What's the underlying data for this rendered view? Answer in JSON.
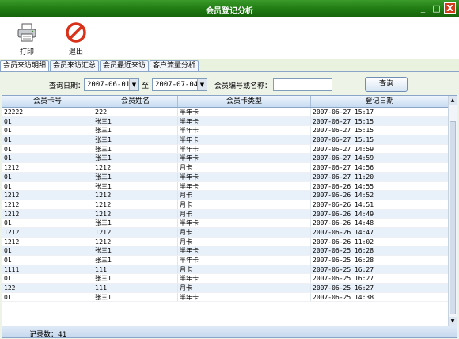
{
  "window": {
    "title": "会员登记分析",
    "buttons": [
      "_",
      "□",
      "X"
    ]
  },
  "toolbar": {
    "print_label": "打印",
    "exit_label": "退出",
    "print_icon": "printer-icon",
    "exit_icon": "no-entry-icon"
  },
  "tabs": [
    "会员来访明细",
    "会员来访汇总",
    "会员最近来访",
    "客户流量分析"
  ],
  "query": {
    "date_label": "查询日期：",
    "start_date": "2007-06-01",
    "to_label": "至",
    "end_date": "2007-07-04",
    "member_label": "会员编号或名称：",
    "member_value": "",
    "search_label": "查询"
  },
  "table": {
    "columns": [
      "会员卡号",
      "会员姓名",
      "会员卡类型",
      "登记日期"
    ],
    "rows": [
      [
        "22222",
        "222",
        "半年卡",
        "2007-06-27 15:17"
      ],
      [
        "01",
        "张三1",
        "半年卡",
        "2007-06-27 15:15"
      ],
      [
        "01",
        "张三1",
        "半年卡",
        "2007-06-27 15:15"
      ],
      [
        "01",
        "张三1",
        "半年卡",
        "2007-06-27 15:15"
      ],
      [
        "01",
        "张三1",
        "半年卡",
        "2007-06-27 14:59"
      ],
      [
        "01",
        "张三1",
        "半年卡",
        "2007-06-27 14:59"
      ],
      [
        "1212",
        "1212",
        "月卡",
        "2007-06-27 14:56"
      ],
      [
        "01",
        "张三1",
        "半年卡",
        "2007-06-27 11:20"
      ],
      [
        "01",
        "张三1",
        "半年卡",
        "2007-06-26 14:55"
      ],
      [
        "1212",
        "1212",
        "月卡",
        "2007-06-26 14:52"
      ],
      [
        "1212",
        "1212",
        "月卡",
        "2007-06-26 14:51"
      ],
      [
        "1212",
        "1212",
        "月卡",
        "2007-06-26 14:49"
      ],
      [
        "01",
        "张三1",
        "半年卡",
        "2007-06-26 14:48"
      ],
      [
        "1212",
        "1212",
        "月卡",
        "2007-06-26 14:47"
      ],
      [
        "1212",
        "1212",
        "月卡",
        "2007-06-26 11:02"
      ],
      [
        "01",
        "张三1",
        "半年卡",
        "2007-06-25 16:28"
      ],
      [
        "01",
        "张三1",
        "半年卡",
        "2007-06-25 16:28"
      ],
      [
        "1111",
        "111",
        "月卡",
        "2007-06-25 16:27"
      ],
      [
        "01",
        "张三1",
        "半年卡",
        "2007-06-25 16:27"
      ],
      [
        "122",
        "111",
        "月卡",
        "2007-06-25 16:27"
      ],
      [
        "01",
        "张三1",
        "半年卡",
        "2007-06-25 14:38"
      ]
    ],
    "record_count_label": "记录数：41"
  }
}
